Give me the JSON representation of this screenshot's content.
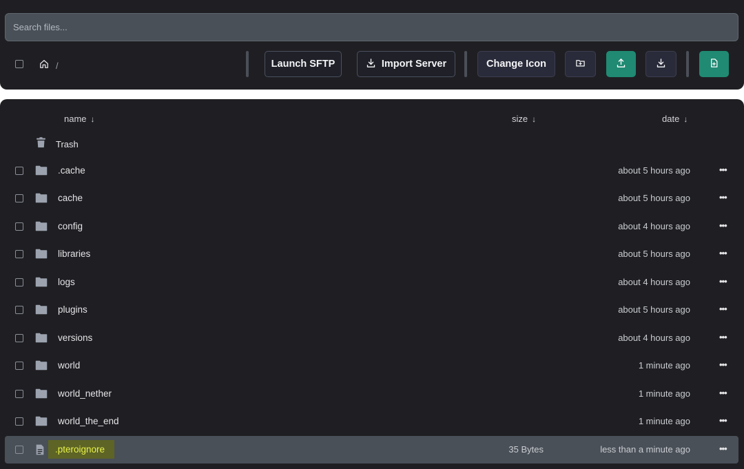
{
  "search": {
    "placeholder": "Search files..."
  },
  "breadcrumb": {
    "separator": "/"
  },
  "toolbar": {
    "launch_sftp": "Launch SFTP",
    "import_server": "Import Server",
    "change_icon": "Change Icon"
  },
  "table": {
    "headers": {
      "name": "name",
      "size": "size",
      "date": "date",
      "sort_arrow": "↓"
    },
    "trash_label": "Trash",
    "more_label": "•••",
    "rows": [
      {
        "name": ".cache",
        "size": "",
        "date": "about 5 hours ago",
        "type": "folder"
      },
      {
        "name": "cache",
        "size": "",
        "date": "about 5 hours ago",
        "type": "folder"
      },
      {
        "name": "config",
        "size": "",
        "date": "about 4 hours ago",
        "type": "folder"
      },
      {
        "name": "libraries",
        "size": "",
        "date": "about 5 hours ago",
        "type": "folder"
      },
      {
        "name": "logs",
        "size": "",
        "date": "about 4 hours ago",
        "type": "folder"
      },
      {
        "name": "plugins",
        "size": "",
        "date": "about 5 hours ago",
        "type": "folder"
      },
      {
        "name": "versions",
        "size": "",
        "date": "about 4 hours ago",
        "type": "folder"
      },
      {
        "name": "world",
        "size": "",
        "date": "1 minute ago",
        "type": "folder"
      },
      {
        "name": "world_nether",
        "size": "",
        "date": "1 minute ago",
        "type": "folder"
      },
      {
        "name": "world_the_end",
        "size": "",
        "date": "1 minute ago",
        "type": "folder"
      },
      {
        "name": ".pteroignore",
        "size": "35 Bytes",
        "date": "less than a minute ago",
        "type": "file"
      }
    ]
  },
  "colors": {
    "panel_bg": "#1f1f23",
    "accent_green": "#208a73",
    "highlight_row": "#4a5058",
    "highlight_text": "#e9f24a"
  }
}
